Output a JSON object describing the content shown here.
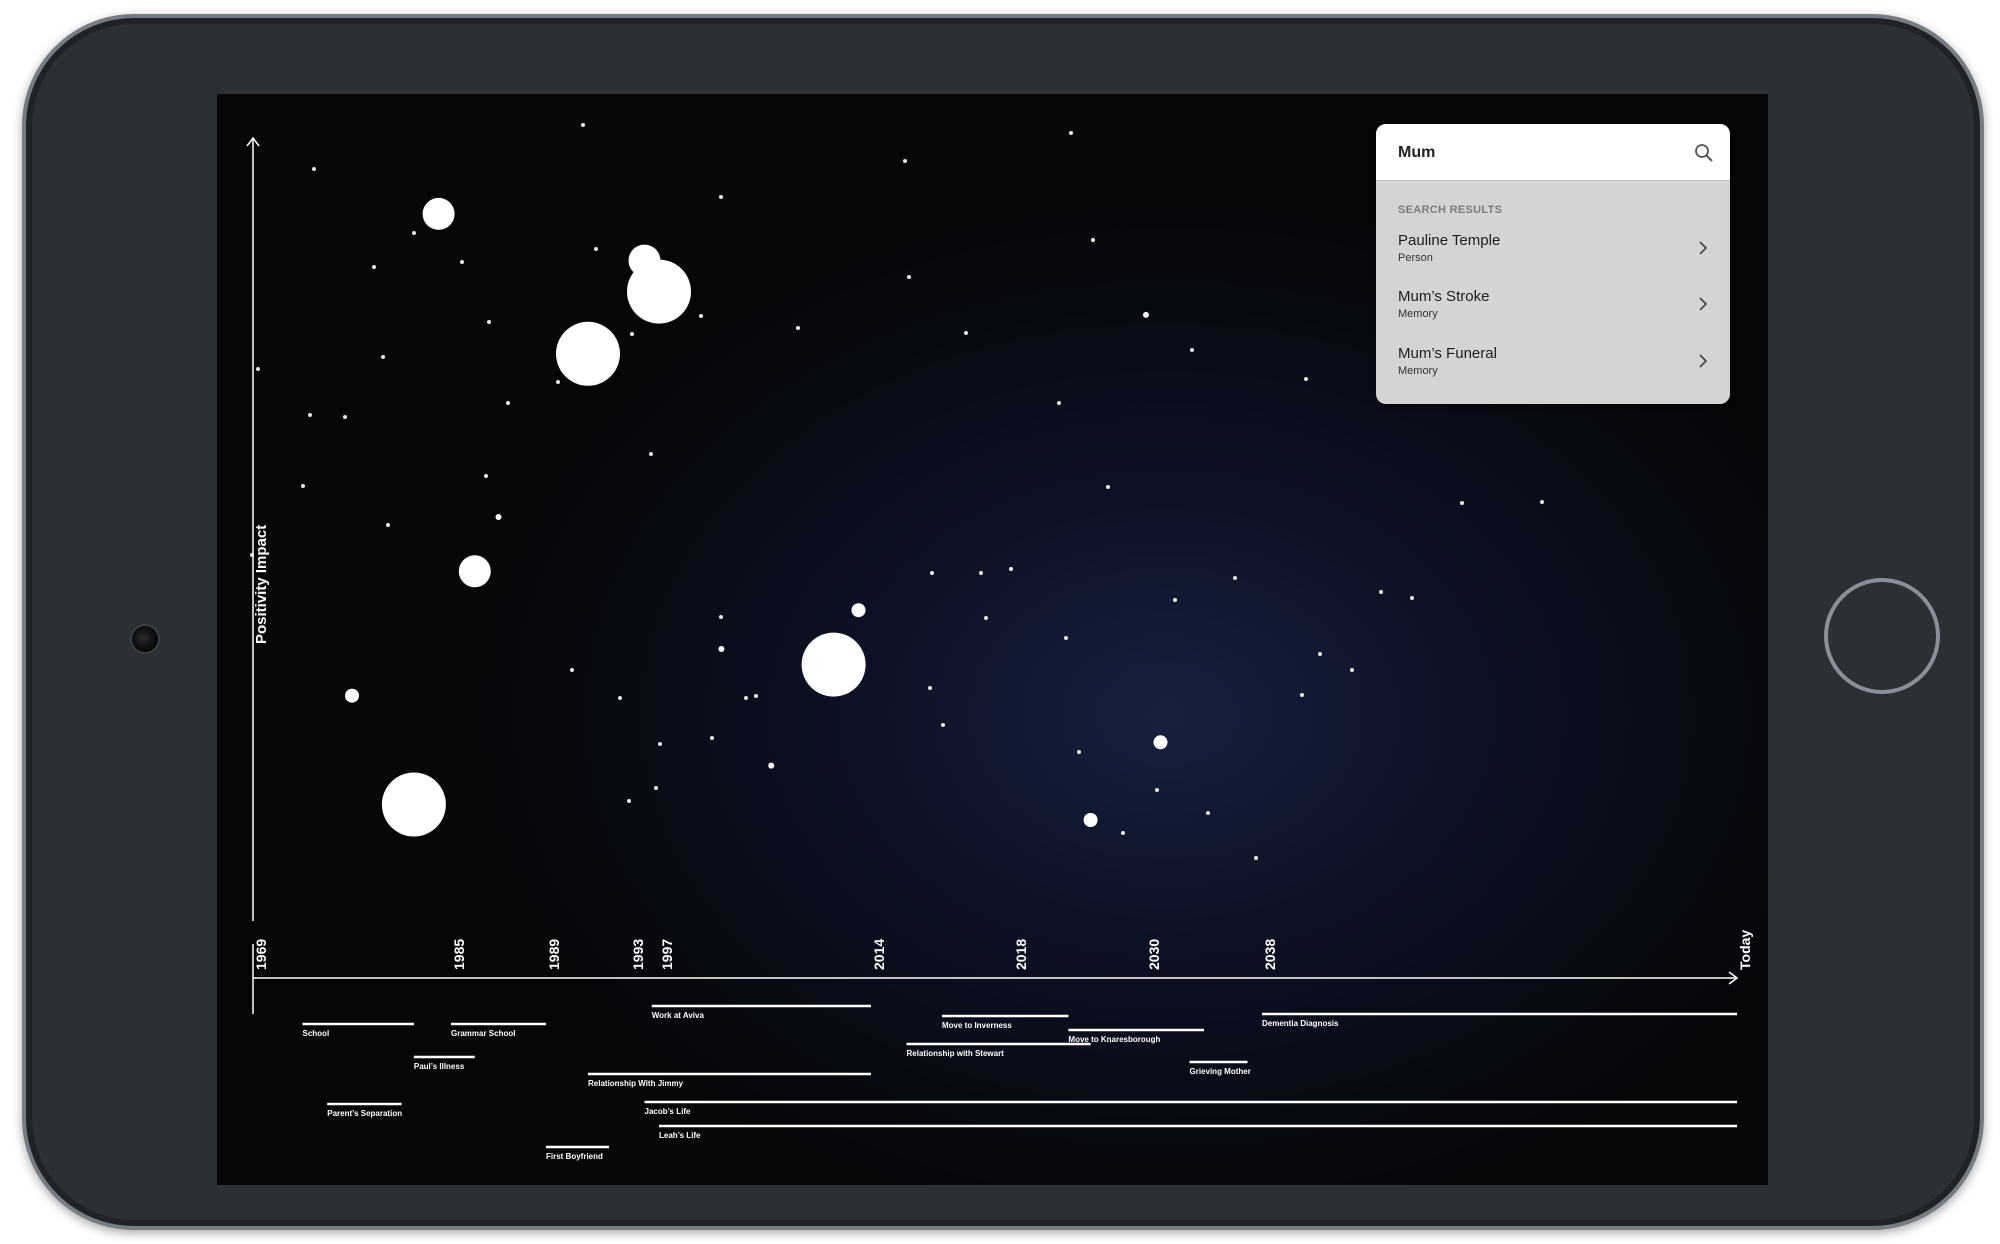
{
  "search": {
    "query": "Mum",
    "results_heading": "SEARCH RESULTS",
    "results": [
      {
        "title": "Pauline Temple",
        "type": "Person"
      },
      {
        "title": "Mum’s Stroke",
        "type": "Memory"
      },
      {
        "title": "Mum’s Funeral",
        "type": "Memory"
      }
    ]
  },
  "chart_data": {
    "type": "scatter",
    "ylabel": "Positivity Impact",
    "x_ticks": [
      "1969",
      "1985",
      "1989",
      "1993",
      "1997",
      "2014",
      "2018",
      "2030",
      "2038",
      "Today"
    ],
    "events": [
      {
        "label": "School",
        "start": 1973,
        "end": 1982
      },
      {
        "label": "Grammar School",
        "start": 1985,
        "end": 1989
      },
      {
        "label": "Paul’s Illness",
        "start": 1982,
        "end": 1986
      },
      {
        "label": "Parent’s Separation",
        "start": 1975,
        "end": 1981
      },
      {
        "label": "First Boyfriend",
        "start": 1989,
        "end": 1992
      },
      {
        "label": "Work at Aviva",
        "start": 1996,
        "end": 2014
      },
      {
        "label": "Relationship With Jimmy",
        "start": 1991,
        "end": 2014
      },
      {
        "label": "Jacob’s Life",
        "start": 1995,
        "end": 2044
      },
      {
        "label": "Leah’s Life",
        "start": 1997,
        "end": 2044
      },
      {
        "label": "Move to Inverness",
        "start": 2016,
        "end": 2023
      },
      {
        "label": "Relationship with Stewart",
        "start": 2015,
        "end": 2025
      },
      {
        "label": "Move to Knaresborough",
        "start": 2023,
        "end": 2034
      },
      {
        "label": "Grieving Mother",
        "start": 2033,
        "end": 2037
      },
      {
        "label": "Dementia Diagnosis",
        "start": 2038,
        "end": 2044
      }
    ],
    "memories": [
      {
        "year": 1984,
        "impact": 0.91,
        "size": "medium"
      },
      {
        "year": 1991,
        "impact": 0.73,
        "size": "large"
      },
      {
        "year": 1995,
        "impact": 0.85,
        "size": "medium"
      },
      {
        "year": 1997,
        "impact": 0.81,
        "size": "large"
      },
      {
        "year": 1986,
        "impact": 0.45,
        "size": "medium"
      },
      {
        "year": 1977,
        "impact": 0.29,
        "size": "small"
      },
      {
        "year": 1982,
        "impact": 0.15,
        "size": "large"
      },
      {
        "year": 2011,
        "impact": 0.33,
        "size": "large"
      },
      {
        "year": 2013,
        "impact": 0.4,
        "size": "small"
      },
      {
        "year": 2025,
        "impact": 0.13,
        "size": "small"
      },
      {
        "year": 2031,
        "impact": 0.23,
        "size": "small"
      },
      {
        "year": 2030,
        "impact": 0.78,
        "size": "tiny"
      },
      {
        "year": 1987,
        "impact": 0.52,
        "size": "tiny"
      },
      {
        "year": 2002,
        "impact": 0.35,
        "size": "tiny"
      },
      {
        "year": 2006,
        "impact": 0.2,
        "size": "tiny"
      }
    ]
  }
}
